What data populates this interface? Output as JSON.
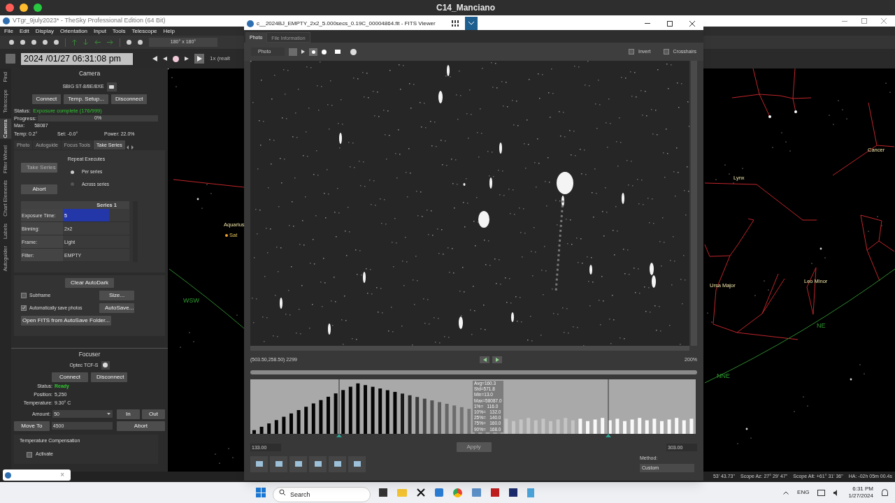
{
  "mac_window": {
    "title": "C14_Manciano"
  },
  "app": {
    "title": "VTgr_9july2023* - TheSky Professional Edition (64 Bit)",
    "menu": [
      "File",
      "Edit",
      "Display",
      "Orientation",
      "Input",
      "Tools",
      "Telescope",
      "Help"
    ],
    "fov": "180° x 180°",
    "date_time": "2024 /01/27 06:31:08 pm",
    "rate": "1x (realt",
    "side_tabs": [
      {
        "label": "Find",
        "selected": false
      },
      {
        "label": "Telescope",
        "selected": false
      },
      {
        "label": "Camera",
        "selected": true
      },
      {
        "label": "Filter Wheel",
        "selected": false
      },
      {
        "label": "Chart Elements",
        "selected": false
      },
      {
        "label": "Labels",
        "selected": false
      },
      {
        "label": "Autoguider",
        "selected": false
      }
    ]
  },
  "camera": {
    "title": "Camera",
    "device": "SBIG ST-8/8E/8XE",
    "buttons": [
      "Connect",
      "Temp. Setup...",
      "Disconnect"
    ],
    "status_label": "Status:",
    "status": "Exposure complete (176/999)",
    "progress_label": "Progress:",
    "progress": "0%",
    "level": 0,
    "max_label": "Max:",
    "max": "58087",
    "temp": "Temp: 0.2°",
    "set": "Set: -0.0°",
    "power": "Power: 22.0%",
    "tabs": [
      {
        "label": "Photo",
        "selected": false
      },
      {
        "label": "Autoguide",
        "selected": false
      },
      {
        "label": "Focus Tools",
        "selected": false
      },
      {
        "label": "Take Series",
        "selected": true
      }
    ],
    "take_series": {
      "label": "Take Series",
      "disabled": true
    },
    "abort": "Abort",
    "repeat": {
      "title": "Repeat Executes",
      "options": [
        {
          "label": "Per series",
          "selected": true
        },
        {
          "label": "Across series",
          "selected": false
        }
      ]
    },
    "series": {
      "title": "Series 1",
      "rows": [
        {
          "label": "Exposure Time:",
          "value": "5",
          "selected": true
        },
        {
          "label": "Binning:",
          "value": "2x2",
          "selected": false
        },
        {
          "label": "Frame:",
          "value": "Light",
          "selected": false
        },
        {
          "label": "Filter:",
          "value": "EMPTY",
          "selected": false
        }
      ]
    },
    "clear_autodark": "Clear AutoDark",
    "subframe": {
      "label": "Subframe",
      "checked": false
    },
    "size_button": "Size...",
    "autosave": {
      "label": "Automatically save photos",
      "checked": true
    },
    "autosave_button": "AutoSave...",
    "open_fits": "Open FITS from AutoSave Folder..."
  },
  "focuser": {
    "title": "Focuser",
    "device": "Optec TCF-S",
    "buttons": [
      "Connect",
      "Disconnect"
    ],
    "fields": [
      {
        "label": "Status:",
        "value": "Ready",
        "kind": "status"
      },
      {
        "label": "Position:",
        "value": "5,250",
        "kind": "plain"
      },
      {
        "label": "Temperature:",
        "value": "9.30° C",
        "kind": "plain"
      }
    ],
    "amount_label": "Amount:",
    "amount": "50",
    "in": "In",
    "out": "Out",
    "move_to": "Move To",
    "move_value": "4500",
    "abort": "Abort",
    "temp_comp": "Temperature Compensation",
    "activate": {
      "label": "Activate",
      "checked": false
    }
  },
  "chart_labels": [
    {
      "text": "Aquarius",
      "kind": "constellation"
    },
    {
      "text": "Sat",
      "kind": "planet"
    },
    {
      "text": "WSW",
      "kind": "horizon"
    },
    {
      "text": "Lynx",
      "kind": "constellation"
    },
    {
      "text": "Cancer",
      "kind": "constellation"
    },
    {
      "text": "Ursa Major",
      "kind": "constellation"
    },
    {
      "text": "Leo Minor",
      "kind": "constellation"
    },
    {
      "text": "NE",
      "kind": "horizon"
    },
    {
      "text": "NNE",
      "kind": "horizon"
    }
  ],
  "status_bar": [
    "53' 43.73\"",
    "Scope Az: 27° 29' 47\"",
    "Scope Alt: +61° 31' 36\"",
    "HA: -02h 05m 00.4s"
  ],
  "fits": {
    "title": "c__2024BJ_EMPTY_2x2_5.000secs_0.19C_00004864.fit - FITS Viewer",
    "tabs": [
      {
        "label": "Photo",
        "selected": true
      },
      {
        "label": "File Information",
        "selected": false
      }
    ],
    "view_select": "Photo",
    "invert": {
      "label": "Invert",
      "checked": false
    },
    "crosshairs": {
      "label": "Crosshairs",
      "checked": false
    },
    "cursor_readout": "(503.50,258.50) 2299",
    "zoom": "200%",
    "stats": [
      "Avg=160.3",
      "Std=571.8",
      "Min=13.0",
      "Max=58087.0",
      "1%=   116.0",
      "10%=   132.0",
      "25%=   140.0",
      "75%=   160.0",
      "90%=   168.0"
    ],
    "low": "133.00",
    "high": "303.00",
    "apply": {
      "label": "Apply",
      "disabled": true
    },
    "method_label": "Method:",
    "method": "Custom"
  },
  "preview": {
    "close": "×"
  },
  "taskbar": {
    "search_placeholder": "Search",
    "language": "ENG",
    "time": "6:31 PM",
    "date": "1/27/2024"
  }
}
